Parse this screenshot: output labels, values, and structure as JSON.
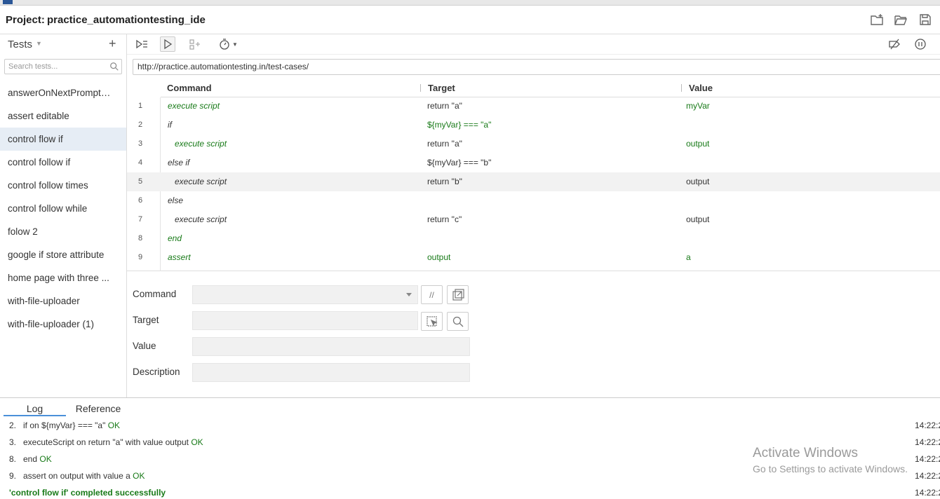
{
  "project": {
    "label": "Project:",
    "name": "practice_automationtesting_ide"
  },
  "sidebar": {
    "title": "Tests",
    "search_placeholder": "Search tests...",
    "tests": [
      {
        "label": "answerOnNextPrompt ..."
      },
      {
        "label": "assert editable"
      },
      {
        "label": "control flow if",
        "selected": true
      },
      {
        "label": "control follow if"
      },
      {
        "label": "control follow times"
      },
      {
        "label": "control follow while"
      },
      {
        "label": "folow 2"
      },
      {
        "label": "google if store attribute"
      },
      {
        "label": "home page with three ..."
      },
      {
        "label": "with-file-uploader"
      },
      {
        "label": "with-file-uploader (1)"
      }
    ]
  },
  "url": "http://practice.automationtesting.in/test-cases/",
  "table": {
    "headers": {
      "command": "Command",
      "target": "Target",
      "value": "Value"
    },
    "rows": [
      {
        "num": "1",
        "command": "execute script",
        "target": "return \"a\"",
        "value": "myVar"
      },
      {
        "num": "2",
        "command": "if",
        "target": "${myVar} === \"a\"",
        "value": ""
      },
      {
        "num": "3",
        "command": "execute script",
        "target": "return \"a\"",
        "value": "output"
      },
      {
        "num": "4",
        "command": "else if",
        "target": "${myVar} === \"b\"",
        "value": ""
      },
      {
        "num": "5",
        "command": "execute script",
        "target": "return \"b\"",
        "value": "output"
      },
      {
        "num": "6",
        "command": "else",
        "target": "",
        "value": ""
      },
      {
        "num": "7",
        "command": "execute script",
        "target": "return \"c\"",
        "value": "output"
      },
      {
        "num": "8",
        "command": "end",
        "target": "",
        "value": ""
      },
      {
        "num": "9",
        "command": "assert",
        "target": "output",
        "value": "a"
      }
    ]
  },
  "editor": {
    "command_label": "Command",
    "target_label": "Target",
    "value_label": "Value",
    "description_label": "Description",
    "comment_btn": "//"
  },
  "bottom": {
    "tabs": [
      "Log",
      "Reference"
    ],
    "logs": [
      {
        "ln": "2.",
        "text": "if on ${myVar} === \"a\"",
        "status": "OK",
        "time": "14:22:2"
      },
      {
        "ln": "3.",
        "text": "executeScript on return \"a\" with value output",
        "status": "OK",
        "time": "14:22:2"
      },
      {
        "ln": "8.",
        "text": "end",
        "status": "OK",
        "time": "14:22:2"
      },
      {
        "ln": "9.",
        "text": "assert on output with value a",
        "status": "OK",
        "time": "14:22:2"
      }
    ],
    "final": {
      "text": "'control flow if' completed successfully",
      "time": "14:22:2"
    }
  },
  "watermark": {
    "line1": "Activate Windows",
    "line2": "Go to Settings to activate Windows."
  },
  "colors": {
    "green": "#187a18",
    "selected": "#e6edf5",
    "tab_accent": "#4a90d9"
  }
}
